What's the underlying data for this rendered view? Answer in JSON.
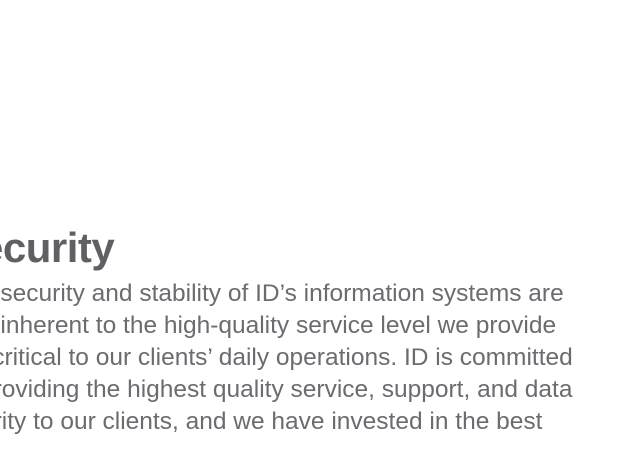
{
  "section": {
    "title": "ecurity",
    "lines": [
      "e security and stability of ID’s information systems are",
      "h inherent to the high-quality service level we provide",
      "l critical to our clients’ daily operations. ID is committed",
      "providing the highest quality service, support, and data",
      "urity to our clients, and we have invested in the best"
    ]
  }
}
